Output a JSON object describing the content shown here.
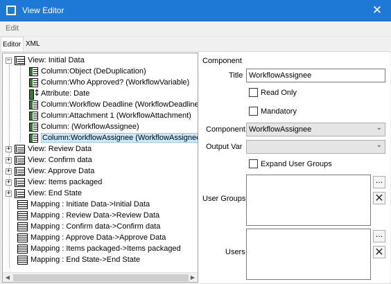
{
  "window": {
    "title": "View Editor",
    "close_glyph": "✕"
  },
  "menu": {
    "edit": "Edit"
  },
  "tabs": [
    {
      "label": "Editor",
      "active": true
    },
    {
      "label": "XML",
      "active": false
    }
  ],
  "tree": {
    "root": {
      "label": "View: Initial Data",
      "expander": "−"
    },
    "children": [
      {
        "icon": "column-icon",
        "label": "Column:Object (DeDuplication)"
      },
      {
        "icon": "column-icon",
        "label": "Column:Who Approved? (WorkflowVariable)"
      },
      {
        "icon": "attribute-icon",
        "label": "Attribute: Date"
      },
      {
        "icon": "column-icon",
        "label": "Column:Workflow Deadline (WorkflowDeadline)"
      },
      {
        "icon": "column-icon",
        "label": "Column:Attachment 1 (WorkflowAttachment)"
      },
      {
        "icon": "column-icon",
        "label": "Column: (WorkflowAssignee)"
      },
      {
        "icon": "column-icon",
        "label": "Column:WorkflowAssignee (WorkflowAssignee)",
        "selected": true
      }
    ],
    "views": [
      {
        "label": "View: Review Data",
        "expander": "+"
      },
      {
        "label": "View: Confirm data",
        "expander": "+"
      },
      {
        "label": "View: Approve Data",
        "expander": "+"
      },
      {
        "label": "View: Items packaged",
        "expander": "+"
      },
      {
        "label": "View: End State",
        "expander": "+"
      }
    ],
    "mappings": [
      {
        "label": "Mapping : Initiate Data->Initial Data"
      },
      {
        "label": "Mapping : Review Data->Review Data"
      },
      {
        "label": "Mapping : Confirm data->Confirm data"
      },
      {
        "label": "Mapping : Approve Data->Approve Data"
      },
      {
        "label": "Mapping : Items packaged->Items packaged"
      },
      {
        "label": "Mapping : End State->End State"
      }
    ]
  },
  "props": {
    "heading": "Component",
    "title_label": "Title",
    "title_value": "WorkflowAssignee",
    "read_only_label": "Read Only",
    "mandatory_label": "Mandatory",
    "component_label": "Component",
    "component_value": "WorkflowAssignee",
    "output_var_label": "Output Var",
    "output_var_value": "",
    "expand_groups_label": "Expand User Groups",
    "user_groups_label": "User Groups",
    "users_label": "Users",
    "browse_glyph": "...",
    "remove_glyph": "✕",
    "chevron_glyph": "⌄"
  },
  "scroll": {
    "left_glyph": "◀",
    "right_glyph": "▶"
  },
  "colors": {
    "titlebar": "#1e78d6",
    "selection": "#cce8ff",
    "column_icon": "#2e7d32"
  }
}
